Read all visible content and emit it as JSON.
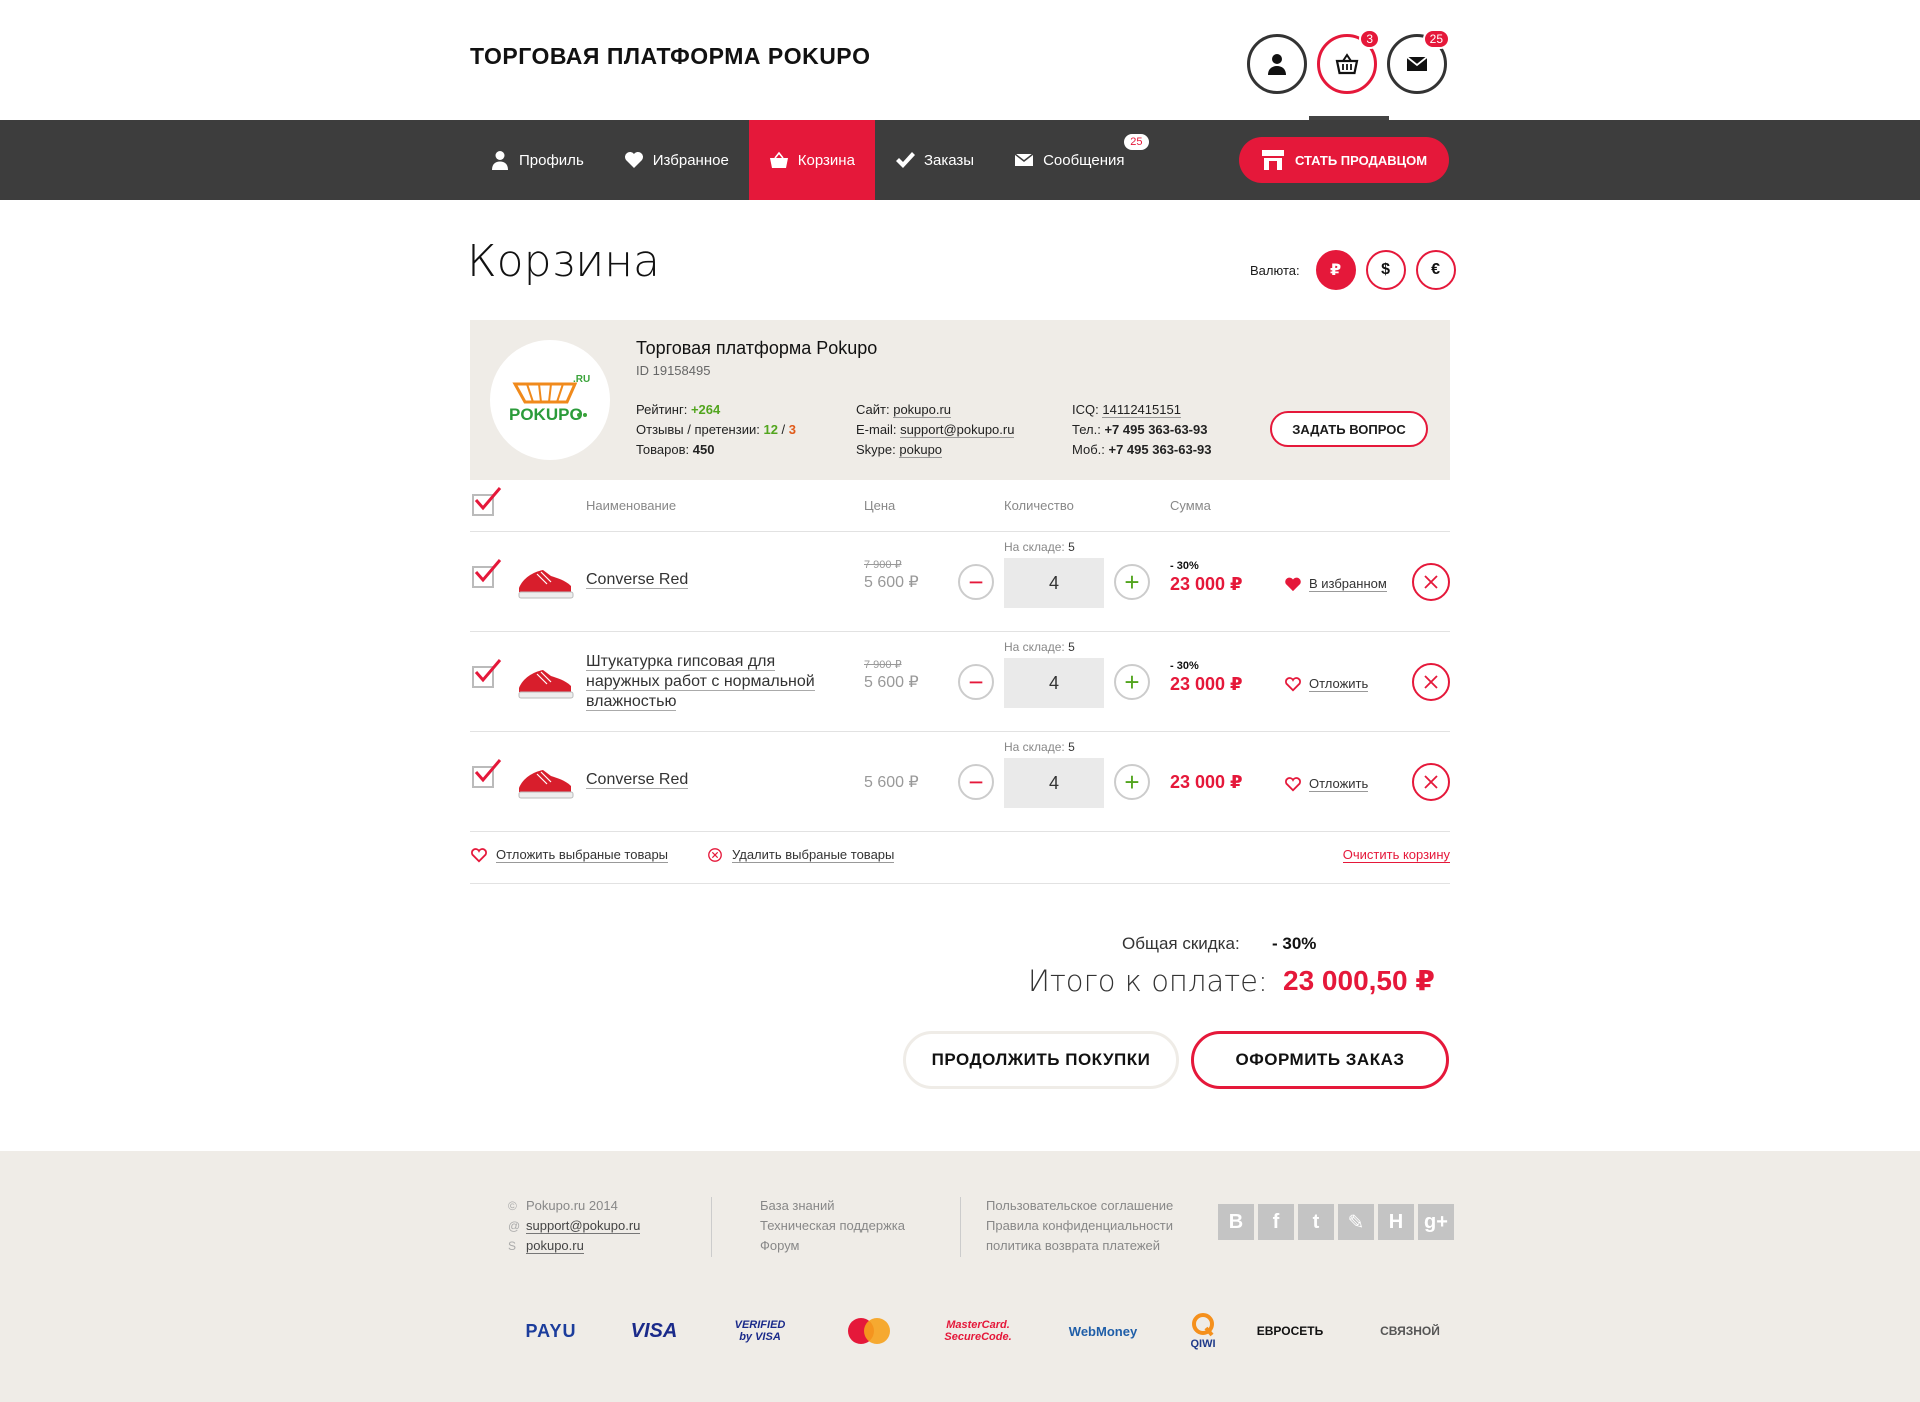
{
  "header": {
    "title": "ТОРГОВАЯ ПЛАТФОРМА POKUPO",
    "cart_count": "3",
    "messages_count": "25"
  },
  "nav": {
    "items": [
      {
        "label": "Профиль",
        "icon": "user-icon"
      },
      {
        "label": "Избранное",
        "icon": "heart-icon"
      },
      {
        "label": "Корзина",
        "icon": "basket-icon",
        "active": true
      },
      {
        "label": "Заказы",
        "icon": "check-icon"
      },
      {
        "label": "Сообщения",
        "icon": "envelope-icon",
        "badge": "25"
      }
    ],
    "seller_button": "СТАТЬ ПРОДАВЦОМ"
  },
  "page": {
    "title": "Корзина",
    "currency_label": "Валюта:",
    "currencies": [
      "₽",
      "$",
      "€"
    ],
    "active_currency": "₽"
  },
  "seller": {
    "name": "Торговая платформа Pokupo",
    "id": "ID 19158495",
    "rating_label": "Рейтинг:",
    "rating": "+264",
    "reviews_label": "Отзывы / претензии:",
    "reviews": "12",
    "claims": "3",
    "goods_label": "Товаров:",
    "goods": "450",
    "site_label": "Сайт:",
    "site": "pokupo.ru",
    "email_label": "E-mail:",
    "email": "support@pokupo.ru",
    "skype_label": "Skype:",
    "skype": "pokupo",
    "icq_label": "ICQ:",
    "icq": "14112415151",
    "phone_label": "Тел.:",
    "phone": "+7 495 363-63-93",
    "mobile_label": "Моб.:",
    "mobile": "+7 495 363-63-93",
    "ask_button": "ЗАДАТЬ ВОПРОС",
    "logo_text": "POKUPO.RU"
  },
  "table": {
    "headers": {
      "name": "Наименование",
      "price": "Цена",
      "qty": "Количество",
      "sum": "Сумма"
    },
    "stock_label": "На складе:",
    "rows": [
      {
        "name": "Converse Red",
        "old_price": "7 900 ₽",
        "price": "5 600 ₽",
        "stock": "5",
        "qty": "4",
        "discount": "- 30%",
        "sum": "23 000 ₽",
        "fav": "В избранном",
        "fav_active": true
      },
      {
        "name": "Штукатурка гипсовая для наружных работ с нормальной влажностью",
        "old_price": "7 900 ₽",
        "price": "5 600 ₽",
        "stock": "5",
        "qty": "4",
        "discount": "- 30%",
        "sum": "23 000 ₽",
        "fav": "Отложить",
        "fav_active": false
      },
      {
        "name": "Converse Red",
        "old_price": "",
        "price": "5 600 ₽",
        "stock": "5",
        "qty": "4",
        "discount": "",
        "sum": "23 000 ₽",
        "fav": "Отложить",
        "fav_active": false
      }
    ]
  },
  "actions": {
    "postpone": "Отложить выбраные товары",
    "delete": "Удалить выбраные товары",
    "clear": "Очистить корзину"
  },
  "totals": {
    "discount_label": "Общая скидка:",
    "discount": "- 30%",
    "total_label": "Итого к оплате:",
    "total": "23 000,50 ₽"
  },
  "buttons": {
    "continue": "ПРОДОЛЖИТЬ ПОКУПКИ",
    "order": "ОФОРМИТЬ ЗАКАЗ"
  },
  "footer": {
    "copyright": "Pokupo.ru 2014",
    "email": "support@pokupo.ru",
    "skype": "pokupo.ru",
    "links1": [
      "База знаний",
      "Техническая поддержка",
      "Форум"
    ],
    "links2": [
      "Пользовательское соглашение",
      "Правила конфиденциальности",
      "политика возврата платежей"
    ],
    "socials": [
      "В",
      "f",
      "t",
      "✎",
      "H",
      "g+"
    ],
    "payments": [
      "PAYU",
      "VISA",
      "VERIFIED by VISA",
      "MasterCard",
      "MasterCard. SecureCode.",
      "WebMoney",
      "QIWI",
      "ЕВРОСЕТЬ",
      "СВЯЗНОЙ"
    ]
  },
  "colors": {
    "accent": "#e5183a",
    "nav_bg": "#3d3d3d",
    "card_bg": "#efece7",
    "green": "#52a51e"
  }
}
